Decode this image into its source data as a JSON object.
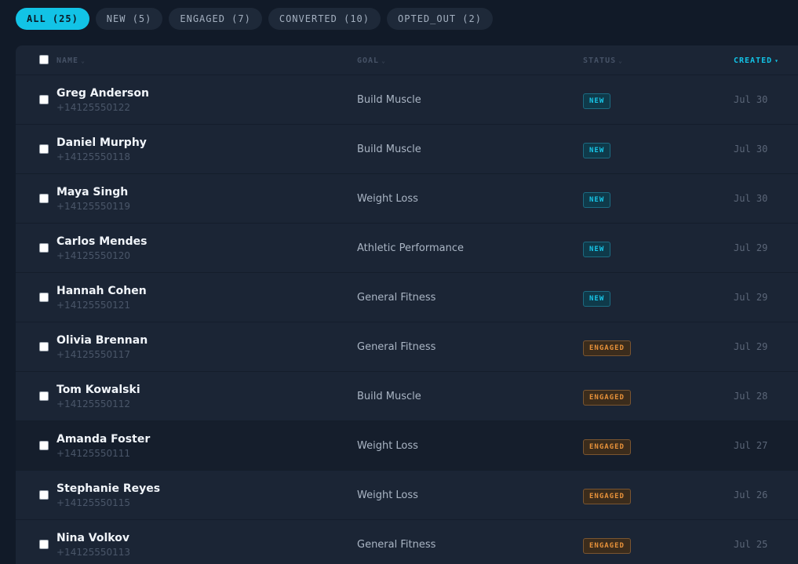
{
  "filters": [
    {
      "label": "ALL (25)",
      "active": true
    },
    {
      "label": "NEW (5)",
      "active": false
    },
    {
      "label": "ENGAGED (7)",
      "active": false
    },
    {
      "label": "CONVERTED (10)",
      "active": false
    },
    {
      "label": "OPTED_OUT (2)",
      "active": false
    }
  ],
  "table": {
    "headers": {
      "name": "NAME",
      "goal": "GOAL",
      "status": "STATUS",
      "created": "CREATED"
    },
    "sort_arrow_inactive": "⌄",
    "sort_arrow_active": "▾",
    "rows": [
      {
        "name": "Greg Anderson",
        "phone": "+14125550122",
        "goal": "Build Muscle",
        "status": "NEW",
        "status_kind": "new",
        "created": "Jul 30"
      },
      {
        "name": "Daniel Murphy",
        "phone": "+14125550118",
        "goal": "Build Muscle",
        "status": "NEW",
        "status_kind": "new",
        "created": "Jul 30"
      },
      {
        "name": "Maya Singh",
        "phone": "+14125550119",
        "goal": "Weight Loss",
        "status": "NEW",
        "status_kind": "new",
        "created": "Jul 30"
      },
      {
        "name": "Carlos Mendes",
        "phone": "+14125550120",
        "goal": "Athletic Performance",
        "status": "NEW",
        "status_kind": "new",
        "created": "Jul 29"
      },
      {
        "name": "Hannah Cohen",
        "phone": "+14125550121",
        "goal": "General Fitness",
        "status": "NEW",
        "status_kind": "new",
        "created": "Jul 29"
      },
      {
        "name": "Olivia Brennan",
        "phone": "+14125550117",
        "goal": "General Fitness",
        "status": "ENGAGED",
        "status_kind": "engaged",
        "created": "Jul 29"
      },
      {
        "name": "Tom Kowalski",
        "phone": "+14125550112",
        "goal": "Build Muscle",
        "status": "ENGAGED",
        "status_kind": "engaged",
        "created": "Jul 28"
      },
      {
        "name": "Amanda Foster",
        "phone": "+14125550111",
        "goal": "Weight Loss",
        "status": "ENGAGED",
        "status_kind": "engaged",
        "created": "Jul 27"
      },
      {
        "name": "Stephanie Reyes",
        "phone": "+14125550115",
        "goal": "Weight Loss",
        "status": "ENGAGED",
        "status_kind": "engaged",
        "created": "Jul 26"
      },
      {
        "name": "Nina Volkov",
        "phone": "+14125550113",
        "goal": "General Fitness",
        "status": "ENGAGED",
        "status_kind": "engaged",
        "created": "Jul 25"
      }
    ]
  },
  "colors": {
    "accent": "#12c3e6",
    "new": "#18c6e8",
    "engaged": "#e8923a",
    "background": "#111a28",
    "card": "#1b2535"
  }
}
